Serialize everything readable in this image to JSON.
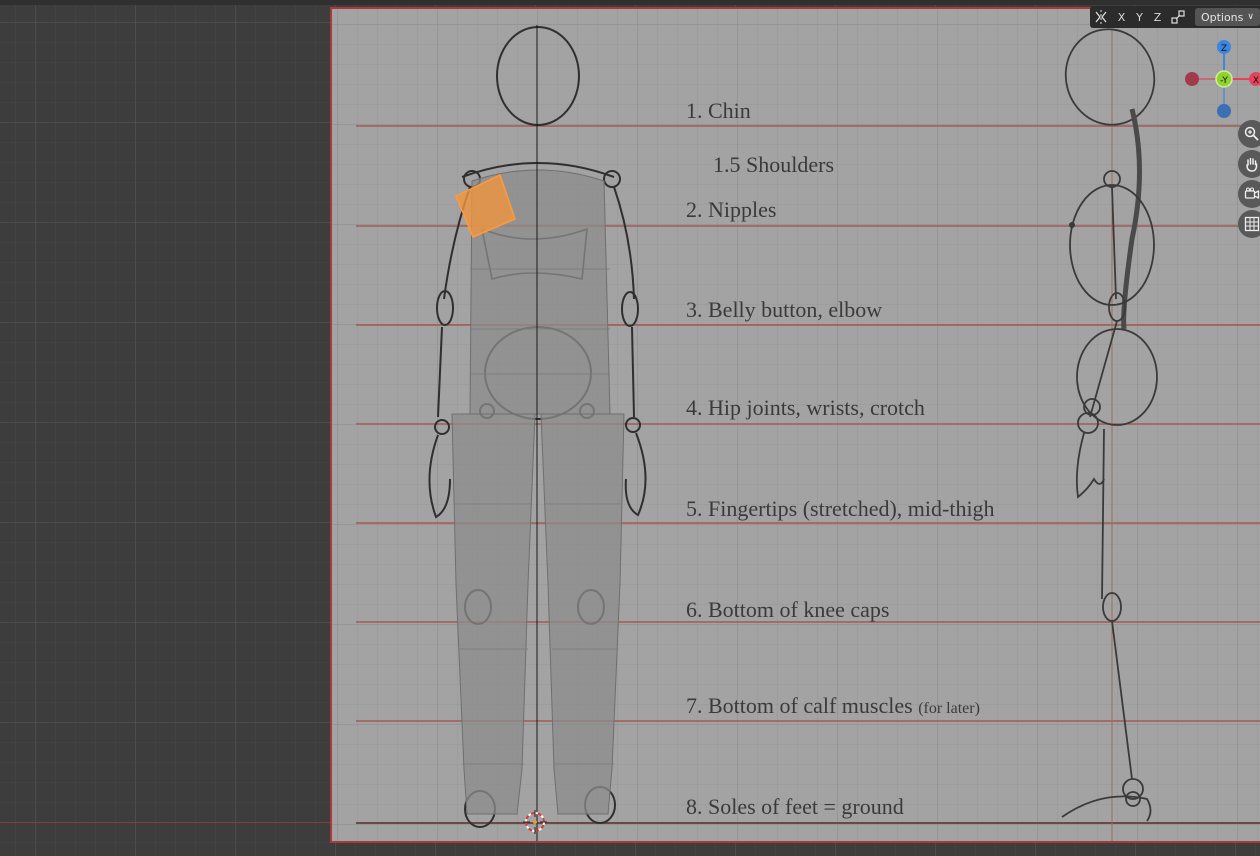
{
  "header": {
    "axis_x_label": "X",
    "axis_y_label": "Y",
    "axis_z_label": "Z",
    "options_label": "Options",
    "icons": [
      "mirror-icon",
      "snap-icon",
      "chevron-down-icon"
    ]
  },
  "gizmo": {
    "z_label": "Z",
    "neg_y_label": "-Y",
    "x_label": "X",
    "colors": {
      "x": "#e3435b",
      "y": "#8fd32b",
      "z": "#3d86e0"
    }
  },
  "navigation": {
    "icons": [
      "zoom-icon",
      "hand-pan-icon",
      "camera-icon",
      "grid-icon"
    ]
  },
  "reference_labels": {
    "chin": "1. Chin",
    "shoulders": "1.5 Shoulders",
    "nipples": "2. Nipples",
    "belly": "3. Belly button, elbow",
    "hips": "4. Hip joints, wrists, crotch",
    "fingertips": "5. Fingertips (stretched), mid-thigh",
    "knees": "6. Bottom of knee caps",
    "calves": "7. Bottom of calf muscles",
    "calves_note": "(for later)",
    "soles": "8. Soles of feet = ground"
  },
  "colors": {
    "viewport_bg": "#3d3d3d",
    "reference_bg": "#a3a3a3",
    "guide_line": "#a35a52",
    "selection": "#f0953e",
    "frame": "#a63b3b"
  }
}
